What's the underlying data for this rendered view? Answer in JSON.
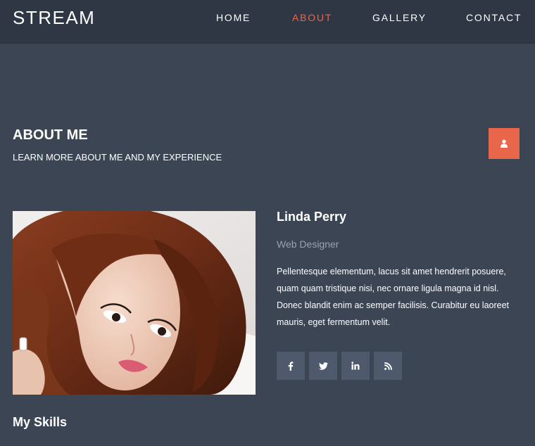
{
  "navbar": {
    "brand": "STREAM",
    "items": [
      {
        "label": "HOME",
        "active": false
      },
      {
        "label": "ABOUT",
        "active": true
      },
      {
        "label": "GALLERY",
        "active": false
      },
      {
        "label": "CONTACT",
        "active": false
      }
    ]
  },
  "section": {
    "title": "ABOUT ME",
    "subtitle": "LEARN MORE ABOUT ME AND MY EXPERIENCE",
    "icon": "user-icon"
  },
  "profile": {
    "name": "Linda Perry",
    "role": "Web Designer",
    "bio": "Pellentesque elementum, lacus sit amet hendrerit posuere, quam quam tristique nisi, nec ornare ligula magna id nisl. Donec blandit enim ac semper facilisis. Curabitur eu laoreet mauris, eget fermentum velit.",
    "photo": "portrait-photo"
  },
  "social": [
    {
      "icon": "facebook-icon",
      "glyph": "f"
    },
    {
      "icon": "twitter-icon",
      "glyph": "bird"
    },
    {
      "icon": "linkedin-icon",
      "glyph": "in"
    },
    {
      "icon": "rss-icon",
      "glyph": "rss"
    }
  ],
  "skills": {
    "title": "My Skills"
  },
  "colors": {
    "background": "#3b4554",
    "navbar": "#2f3744",
    "accent": "#e8674a",
    "social_button": "#4e5a6b",
    "muted_text": "#9aa3b0"
  }
}
